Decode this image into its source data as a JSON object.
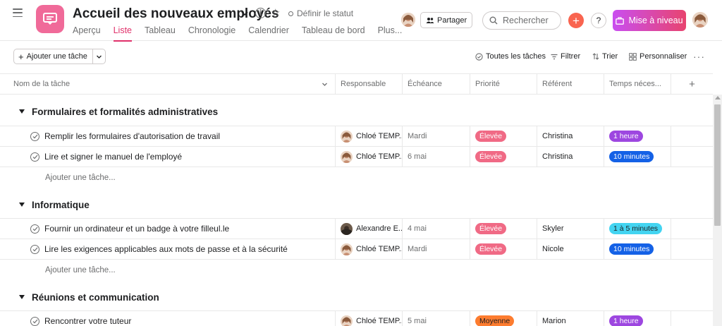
{
  "header": {
    "project_title": "Accueil des nouveaux employés",
    "status_label": "Définir le statut",
    "tabs": [
      {
        "label": "Aperçu"
      },
      {
        "label": "Liste"
      },
      {
        "label": "Tableau"
      },
      {
        "label": "Chronologie"
      },
      {
        "label": "Calendrier"
      },
      {
        "label": "Tableau de bord"
      },
      {
        "label": "Plus..."
      }
    ],
    "active_tab": "Liste",
    "share_label": "Partager",
    "search_placeholder": "Rechercher",
    "help_label": "?",
    "upgrade_label": "Mise à niveau"
  },
  "toolbar": {
    "add_task_label": "Ajouter une tâche",
    "all_tasks_label": "Toutes les tâches",
    "filter_label": "Filtrer",
    "sort_label": "Trier",
    "customize_label": "Personnaliser",
    "more_label": "···"
  },
  "columns": {
    "name": "Nom de la tâche",
    "assignee": "Responsable",
    "due": "Échéance",
    "priority": "Priorité",
    "referent": "Référent",
    "time": "Temps néces..."
  },
  "add_task_row_label": "Ajouter une tâche...",
  "sections": [
    {
      "title": "Formulaires et formalités administratives",
      "tasks": [
        {
          "name": "Remplir les formulaires d'autorisation de travail",
          "assignee": "Chloé TEMP...",
          "due": "Mardi",
          "priority": "Élevée",
          "referent": "Christina",
          "time": "1 heure"
        },
        {
          "name": "Lire et signer le manuel de l'employé",
          "assignee": "Chloé TEMP...",
          "due": "6 mai",
          "priority": "Élevée",
          "referent": "Christina",
          "time": "10 minutes"
        }
      ]
    },
    {
      "title": "Informatique",
      "tasks": [
        {
          "name": "Fournir un ordinateur et un badge à votre filleul.le",
          "assignee": "Alexandre E...",
          "due": "4 mai",
          "priority": "Élevée",
          "referent": "Skyler",
          "time": "1 à 5 minutes"
        },
        {
          "name": "Lire les exigences applicables aux mots de passe et à la sécurité",
          "assignee": "Chloé TEMP...",
          "due": "Mardi",
          "priority": "Élevée",
          "referent": "Nicole",
          "time": "10 minutes"
        }
      ]
    },
    {
      "title": "Réunions et communication",
      "tasks": [
        {
          "name": "Rencontrer votre tuteur",
          "assignee": "Chloé TEMP...",
          "due": "5 mai",
          "priority": "Moyenne",
          "referent": "Marion",
          "time": "1 heure"
        }
      ]
    }
  ],
  "colors": {
    "accent": "#e0306a",
    "priority_high": "#f06a85",
    "priority_medium": "#fd7c2f",
    "time_purple": "#9d47e0",
    "time_blue": "#1461e6",
    "time_cyan": "#43d4f1",
    "project_icon": "#f06a99",
    "plus_button": "#f9644f"
  },
  "icons": {
    "menu": "hamburger-icon",
    "project": "project-message-icon",
    "info": "info-icon",
    "favorite": "star-icon",
    "search": "search-icon",
    "task_complete": "check-circle-icon"
  }
}
